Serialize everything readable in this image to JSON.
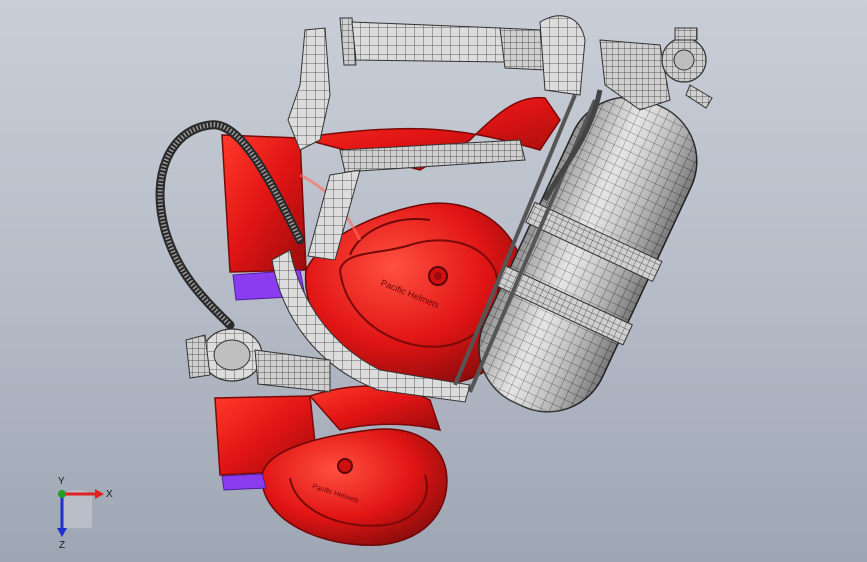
{
  "viewport": {
    "model": "breathing-apparatus-assembly",
    "colors": {
      "background_top": "#c9ced8",
      "background_bottom": "#9ea6b4",
      "shell_red": "#e01414",
      "shell_dark": "#8e0c0c",
      "mesh_light": "#d9d9d9",
      "mesh_line": "#3c3c3c",
      "pad_purple": "#8a3df0"
    },
    "shell_text_upper": "Pacific Helmets",
    "shell_text_lower": "Pacific Helmets"
  },
  "triad": {
    "x_label": "X",
    "y_label": "Y",
    "z_label": "Z",
    "colors": {
      "x": "#e02020",
      "y": "#20a020",
      "z": "#2030d0"
    }
  }
}
